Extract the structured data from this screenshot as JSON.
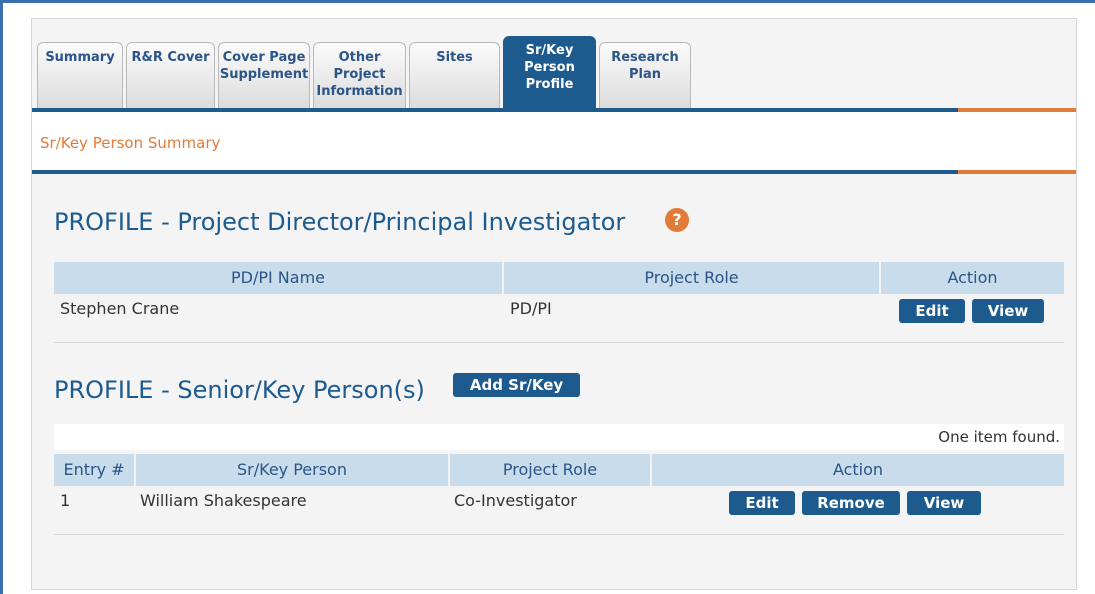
{
  "tabs": [
    {
      "label": "Summary"
    },
    {
      "label": "R&R Cover"
    },
    {
      "label": "Cover Page\nSupplement"
    },
    {
      "label": "Other\nProject\nInformation"
    },
    {
      "label": "Sites"
    },
    {
      "label": "Sr/Key\nPerson\nProfile"
    },
    {
      "label": "Research\nPlan"
    }
  ],
  "subheader": "Sr/Key Person Summary",
  "pdpi": {
    "title": "PROFILE - Project Director/Principal Investigator",
    "help_icon": "question-icon",
    "headers": [
      "PD/PI Name",
      "Project Role",
      "Action"
    ],
    "row": {
      "name": "Stephen Crane",
      "role": "PD/PI"
    },
    "buttons": {
      "edit": "Edit",
      "view": "View"
    }
  },
  "senior": {
    "title": "PROFILE - Senior/Key Person(s)",
    "add_button": "Add Sr/Key",
    "found_text": "One item found.",
    "headers": [
      "Entry #",
      "Sr/Key Person",
      "Project Role",
      "Action"
    ],
    "row": {
      "entry": "1",
      "person": "William Shakespeare",
      "role": "Co-Investigator"
    },
    "buttons": {
      "edit": "Edit",
      "remove": "Remove",
      "view": "View"
    }
  },
  "colors": {
    "accent_blue": "#1d5a8e",
    "accent_orange": "#e07b39",
    "header_bg": "#c9dcec"
  }
}
